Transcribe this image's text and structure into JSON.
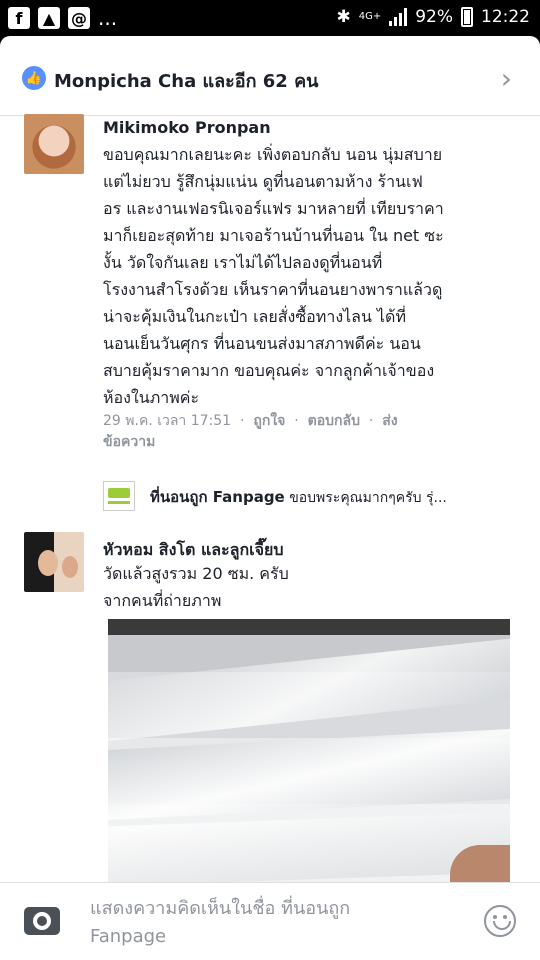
{
  "status_bar": {
    "network": "4G+",
    "battery": "92%",
    "time": "12:22",
    "more": "..."
  },
  "header": {
    "likes_text": "Monpicha Cha และอีก 62 คน",
    "icon": "like-thumb-icon"
  },
  "comments": [
    {
      "author": "Mikimoko Pronpan",
      "lines": [
        "ขอบคุณมากเลยนะคะ เพิ่งตอบกลับ นอน นุ่มสบาย",
        "แต่ไม่ยวบ รู้สึกนุ่มแน่น ดูที่นอนตามห้าง ร้านเฟ",
        "อร และงานเฟอรนิเจอร์แฟร มาหลายที่ เทียบราคา",
        "มาก็เยอะสุดท้าย มาเจอร้านบ้านที่นอน ใน net ซะ",
        "งั้น วัดใจกันเลย เราไม่ได้ไปลองดูที่นอนที่",
        "โรงงานสำโรงด้วย เห็นราคาที่นอนยางพาราแล้วดู",
        "น่าจะคุ้มเงินในกะเป๋า เลยสั่งซื้อทางไลน ได้ที่",
        "นอนเย็นวันศุกร ที่นอนขนส่งมาสภาพดีค่ะ นอน",
        "สบายคุ้มราคามาก ขอบคุณค่ะ จากลูกค้าเจ้าของ",
        "ห้องในภาพค่ะ"
      ],
      "timestamp": "29 พ.ค. เวลา 17:51",
      "actions": [
        "ถูกใจ",
        "ตอบกลับ",
        "ส่ง"
      ],
      "meta_line2": "ข้อความ"
    },
    {
      "author": "หัวหอม สิงโต และลูกเจี๊ยบ",
      "lines": [
        "วัดแล้วสูงรวม 20 ซม. ครับ",
        "จากคนที่ถ่ายภาพ"
      ]
    }
  ],
  "reply_preview": {
    "page_name": "ที่นอนถูก Fanpage",
    "text": "ขอบพระคุณมากๆครับ รุ่..."
  },
  "composer": {
    "placeholder_line1": "แสดงความคิดเห็นในชื่อ ที่นอนถูก",
    "placeholder_line2": "Fanpage"
  },
  "colors": {
    "link_blue": "#5890ff",
    "text": "#1d2129",
    "meta_grey": "#90949c"
  }
}
